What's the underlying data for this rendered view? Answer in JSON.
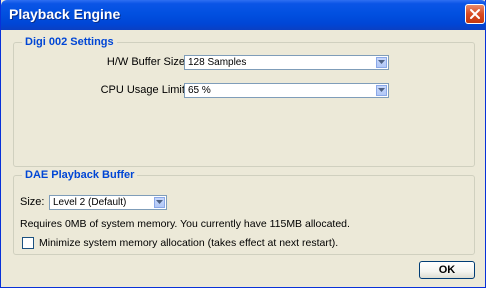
{
  "window": {
    "title": "Playback Engine"
  },
  "digi_settings": {
    "group_title": "Digi 002 Settings",
    "buffer_size_label": "H/W Buffer Size:",
    "buffer_size_value": "128 Samples",
    "cpu_limit_label": "CPU Usage Limit:",
    "cpu_limit_value": "65 %"
  },
  "dae_buffer": {
    "group_title": "DAE Playback Buffer",
    "size_label": "Size:",
    "size_value": "Level 2 (Default)",
    "memory_info": "Requires 0MB of system memory. You currently have 115MB allocated.",
    "minimize_label": "Minimize system memory allocation (takes effect at next restart).",
    "minimize_checked": false
  },
  "buttons": {
    "ok_label": "OK"
  },
  "colors": {
    "title_bar": "#0150e0",
    "group_title": "#0046d5",
    "dialog_bg": "#ece9d8",
    "close_button": "#d84a22"
  }
}
